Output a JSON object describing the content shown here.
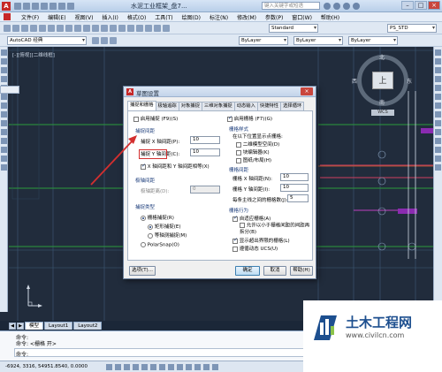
{
  "titlebar": {
    "logo": "A",
    "doc_title": "水泥工业框架_盘7...",
    "search_placeholder": "键入关键字或短语",
    "minimize": "–",
    "maximize": "□",
    "close": "×"
  },
  "menu": [
    "文件(F)",
    "编辑(E)",
    "视图(V)",
    "插入(I)",
    "格式(O)",
    "工具(T)",
    "绘图(D)",
    "标注(N)",
    "修改(M)",
    "参数(P)",
    "窗口(W)",
    "帮助(H)"
  ],
  "toolbar": {
    "workspace": "AutoCAD 经典",
    "text_style": "Standard",
    "dim_style": "PS_STD",
    "layer_color": "ByLayer",
    "linetype": "ByLayer",
    "lineweight": "ByLayer"
  },
  "viewport": {
    "label": "[-][俯视][二维线框]"
  },
  "viewcube": {
    "north": "北",
    "south": "南",
    "west": "西",
    "east": "东",
    "top": "上",
    "wcs": "WCS"
  },
  "layout_tabs": [
    "模型",
    "Layout1",
    "Layout2"
  ],
  "command": {
    "line1": "命令:",
    "line2": "命令: <栅格 开>",
    "prompt": "命令:"
  },
  "status": {
    "coords": "-6924, 3316, 54951.8540, 0.0000",
    "model": "模型"
  },
  "dialog": {
    "title": "草图设置",
    "close": "×",
    "tabs": [
      "捕捉和栅格",
      "极轴追踪",
      "对象捕捉",
      "三维对象捕捉",
      "动态输入",
      "快捷特性",
      "选择循环"
    ],
    "snap_on": "启用捕捉 (F9)(S)",
    "snap_spacing": {
      "group": "捕捉间距",
      "x_label": "捕捉 X 轴间距(P):",
      "x_value": "10",
      "y_label": "捕捉 Y 轴间距(C):",
      "y_value": "10",
      "equal": "X 轴间距和 Y 轴间距相等(X)"
    },
    "polar_spacing": {
      "group": "极轴间距",
      "distance_label": "极轴距离(D):",
      "distance_value": "0"
    },
    "snap_type": {
      "group": "捕捉类型",
      "grid_snap": "栅格捕捉(R)",
      "rect_snap": "矩形捕捉(E)",
      "iso_snap": "等轴测捕捉(M)",
      "polar_snap": "PolarSnap(O)"
    },
    "grid_on": "启用栅格 (F7)(G)",
    "grid_style": {
      "group": "栅格样式",
      "desc": "在以下位置显示点栅格:",
      "model": "二维模型空间(D)",
      "block": "块编辑器(K)",
      "sheet": "图纸/布局(H)"
    },
    "grid_spacing": {
      "group": "栅格间距",
      "x_label": "栅格 X 轴间距(N):",
      "x_value": "10",
      "y_label": "栅格 Y 轴间距(I):",
      "y_value": "10",
      "major_label": "每条主线之间的栅格数(J):",
      "major_value": "5"
    },
    "grid_behavior": {
      "group": "栅格行为",
      "adaptive": "自适应栅格(A)",
      "subdivide": "允许以小于栅格间距的间距再拆分(B)",
      "beyond": "显示超出界限的栅格(L)",
      "follow_ucs": "遵循动态 UCS(U)"
    },
    "options_btn": "选项(T)...",
    "ok_btn": "确定",
    "cancel_btn": "取消",
    "help_btn": "帮助(H)"
  },
  "watermark": {
    "name": "土木工程网",
    "url": "www.civilcn.com"
  },
  "colors": {
    "canvas": "#212c3c",
    "annotation_red": "#d32f2f",
    "watermark_blue": "#1d4f8f"
  }
}
